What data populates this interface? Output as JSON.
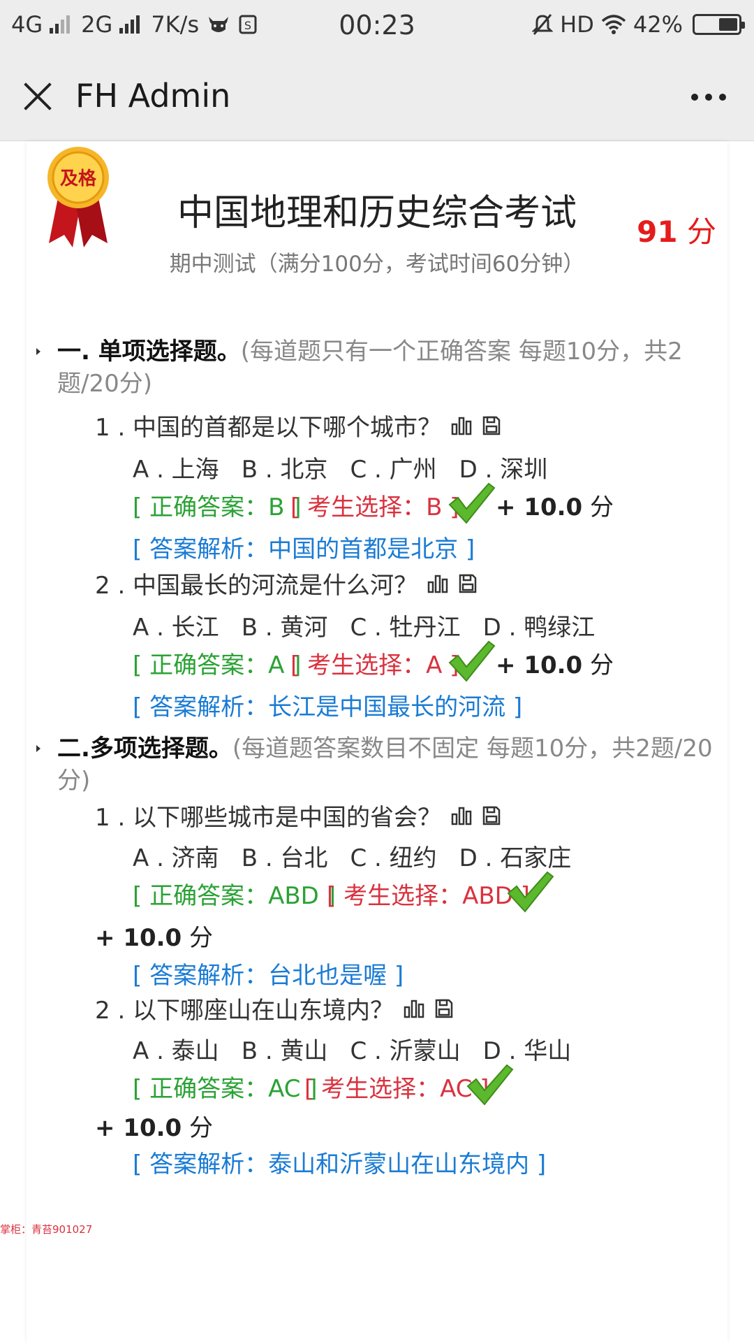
{
  "status_bar": {
    "network1": "4G",
    "network2": "2G",
    "speed": "7K/s",
    "time": "00:23",
    "hd": "HD",
    "battery": "42%",
    "battery_level": 0.42
  },
  "nav": {
    "title": "FH Admin"
  },
  "exam": {
    "badge_text": "及格",
    "title": "中国地理和历史综合考试",
    "subtitle": "期中测试（满分100分，考试时间60分钟）",
    "score_value": "91",
    "score_unit": "分"
  },
  "sections": [
    {
      "head": "一. 单项选择题。",
      "desc": "(每道题只有一个正确答案 每题10分，共2题/20分)",
      "questions": [
        {
          "text": "1 . 中国的首都是以下哪个城市？",
          "options": [
            "A . 上海",
            "B . 北京",
            "C . 广州",
            "D . 深圳"
          ],
          "correct": "[ 正确答案：B ]",
          "chosen": "[ 考生选择：B ]",
          "points": "+ 10.0",
          "points_unit": "分",
          "analysis": "[ 答案解析：中国的首都是北京 ]"
        },
        {
          "text": "2 . 中国最长的河流是什么河？",
          "options": [
            "A . 长江",
            "B . 黄河",
            "C . 牡丹江",
            "D . 鸭绿江"
          ],
          "correct": "[ 正确答案：A ]",
          "chosen": "[ 考生选择：A ]",
          "points": "+ 10.0",
          "points_unit": "分",
          "analysis": "[ 答案解析：长江是中国最长的河流 ]"
        }
      ]
    },
    {
      "head": "二.多项选择题。",
      "desc": "(每道题答案数目不固定 每题10分，共2题/20分)",
      "questions": [
        {
          "text": "1 . 以下哪些城市是中国的省会？",
          "options": [
            "A . 济南",
            "B . 台北",
            "C . 纽约",
            "D . 石家庄"
          ],
          "correct": "[ 正确答案：ABD ]",
          "chosen": "[ 考生选择：ABD ]",
          "points": "+ 10.0",
          "points_unit": "分",
          "analysis": "[ 答案解析：台北也是喔 ]"
        },
        {
          "text": "2 . 以下哪座山在山东境内？",
          "options": [
            "A . 泰山",
            "B . 黄山",
            "C . 沂蒙山",
            "D . 华山"
          ],
          "correct": "[ 正确答案：AC ]",
          "chosen": "[ 考生选择：AC ]",
          "points": "+ 10.0",
          "points_unit": "分",
          "analysis": "[ 答案解析：泰山和沂蒙山在山东境内 ]"
        }
      ]
    }
  ],
  "watermark": "掌柜：青苔901027",
  "colors": {
    "correct": "#2aa234",
    "chosen": "#d9323e",
    "analysis": "#1a7bd4",
    "score": "#e41c1c"
  }
}
